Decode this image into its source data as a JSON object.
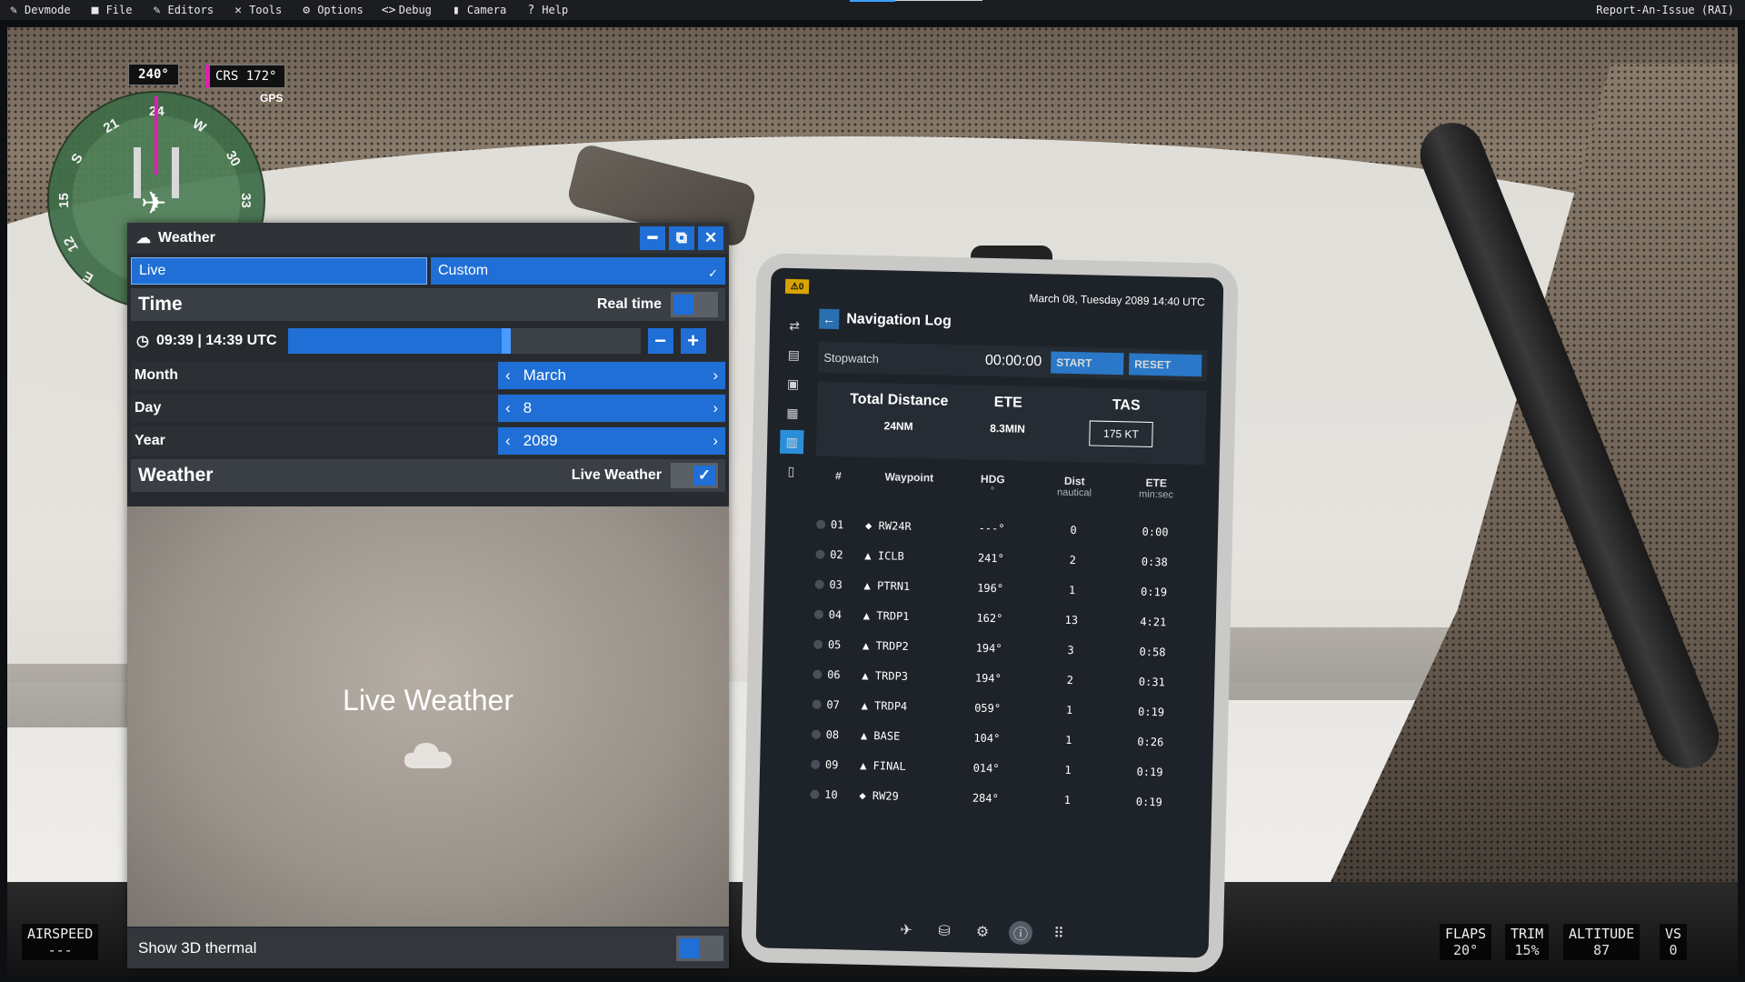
{
  "menubar": {
    "items": [
      {
        "label": "Devmode",
        "icon": "devmode-icon",
        "glyph": "✎"
      },
      {
        "label": "File",
        "icon": "folder-icon",
        "glyph": "■"
      },
      {
        "label": "Editors",
        "icon": "pencil-icon",
        "glyph": "✎"
      },
      {
        "label": "Tools",
        "icon": "tools-icon",
        "glyph": "✕"
      },
      {
        "label": "Options",
        "icon": "gear-icon",
        "glyph": "⚙"
      },
      {
        "label": "Debug",
        "icon": "code-icon",
        "glyph": "<>"
      },
      {
        "label": "Camera",
        "icon": "camera-icon",
        "glyph": "▮"
      },
      {
        "label": "Help",
        "icon": "help-icon",
        "glyph": "?"
      }
    ],
    "report": "Report-An-Issue (RAI)"
  },
  "hsi": {
    "heading": "240°",
    "course": "CRS 172°",
    "nav_source": "GPS",
    "dial_labels": [
      "24",
      "W",
      "30",
      "33",
      "21",
      "S",
      "15",
      "12",
      "E"
    ]
  },
  "weather": {
    "title": "Weather",
    "tabs": {
      "live": "Live",
      "custom": "Custom"
    },
    "time_section": "Time",
    "real_time_label": "Real time",
    "time_value": "09:39 | 14:39 UTC",
    "time_fraction": 0.62,
    "rows": {
      "month_label": "Month",
      "month_value": "March",
      "day_label": "Day",
      "day_value": "8",
      "year_label": "Year",
      "year_value": "2089"
    },
    "weather_section": "Weather",
    "live_weather_label": "Live Weather",
    "body_title": "Live Weather",
    "footer_label": "Show 3D thermal"
  },
  "tablet": {
    "warning_count": "0",
    "date": "March 08, Tuesday 2089 14:40 UTC",
    "title": "Navigation Log",
    "stopwatch_label": "Stopwatch",
    "stopwatch_value": "00:00:00",
    "start_label": "START",
    "reset_label": "RESET",
    "summary": {
      "dist_label": "Total Distance",
      "dist_value": "24NM",
      "ete_label": "ETE",
      "ete_value": "8.3MIN",
      "tas_label": "TAS",
      "tas_value": "175 KT"
    },
    "columns": {
      "num": "#",
      "waypoint": "Waypoint",
      "hdg": "HDG",
      "hdg_unit": "°",
      "dist": "Dist",
      "dist_unit": "nautical",
      "ete": "ETE",
      "ete_unit": "min:sec"
    },
    "rows": [
      {
        "num": "01",
        "glyph": "◆",
        "wp": "RW24R",
        "hdg": "---°",
        "dist": "0",
        "ete": "0:00"
      },
      {
        "num": "02",
        "glyph": "▲",
        "wp": "ICLB",
        "hdg": "241°",
        "dist": "2",
        "ete": "0:38"
      },
      {
        "num": "03",
        "glyph": "▲",
        "wp": "PTRN1",
        "hdg": "196°",
        "dist": "1",
        "ete": "0:19"
      },
      {
        "num": "04",
        "glyph": "▲",
        "wp": "TRDP1",
        "hdg": "162°",
        "dist": "13",
        "ete": "4:21"
      },
      {
        "num": "05",
        "glyph": "▲",
        "wp": "TRDP2",
        "hdg": "194°",
        "dist": "3",
        "ete": "0:58"
      },
      {
        "num": "06",
        "glyph": "▲",
        "wp": "TRDP3",
        "hdg": "194°",
        "dist": "2",
        "ete": "0:31"
      },
      {
        "num": "07",
        "glyph": "▲",
        "wp": "TRDP4",
        "hdg": "059°",
        "dist": "1",
        "ete": "0:19"
      },
      {
        "num": "08",
        "glyph": "▲",
        "wp": "BASE",
        "hdg": "104°",
        "dist": "1",
        "ete": "0:26"
      },
      {
        "num": "09",
        "glyph": "▲",
        "wp": "FINAL",
        "hdg": "014°",
        "dist": "1",
        "ete": "0:19"
      },
      {
        "num": "10",
        "glyph": "◆",
        "wp": "RW29",
        "hdg": "284°",
        "dist": "1",
        "ete": "0:19"
      }
    ]
  },
  "hud": {
    "airspeed_label": "AIRSPEED",
    "airspeed_value": "---",
    "flaps_label": "FLAPS",
    "flaps_value": "20°",
    "trim_label": "TRIM",
    "trim_value": "15%",
    "altitude_label": "ALTITUDE",
    "altitude_value": "87",
    "vs_label": "VS",
    "vs_value": "0"
  },
  "colors": {
    "accent": "#1f6fd6",
    "course_needle": "#e21fb4",
    "panel": "#272b30"
  }
}
